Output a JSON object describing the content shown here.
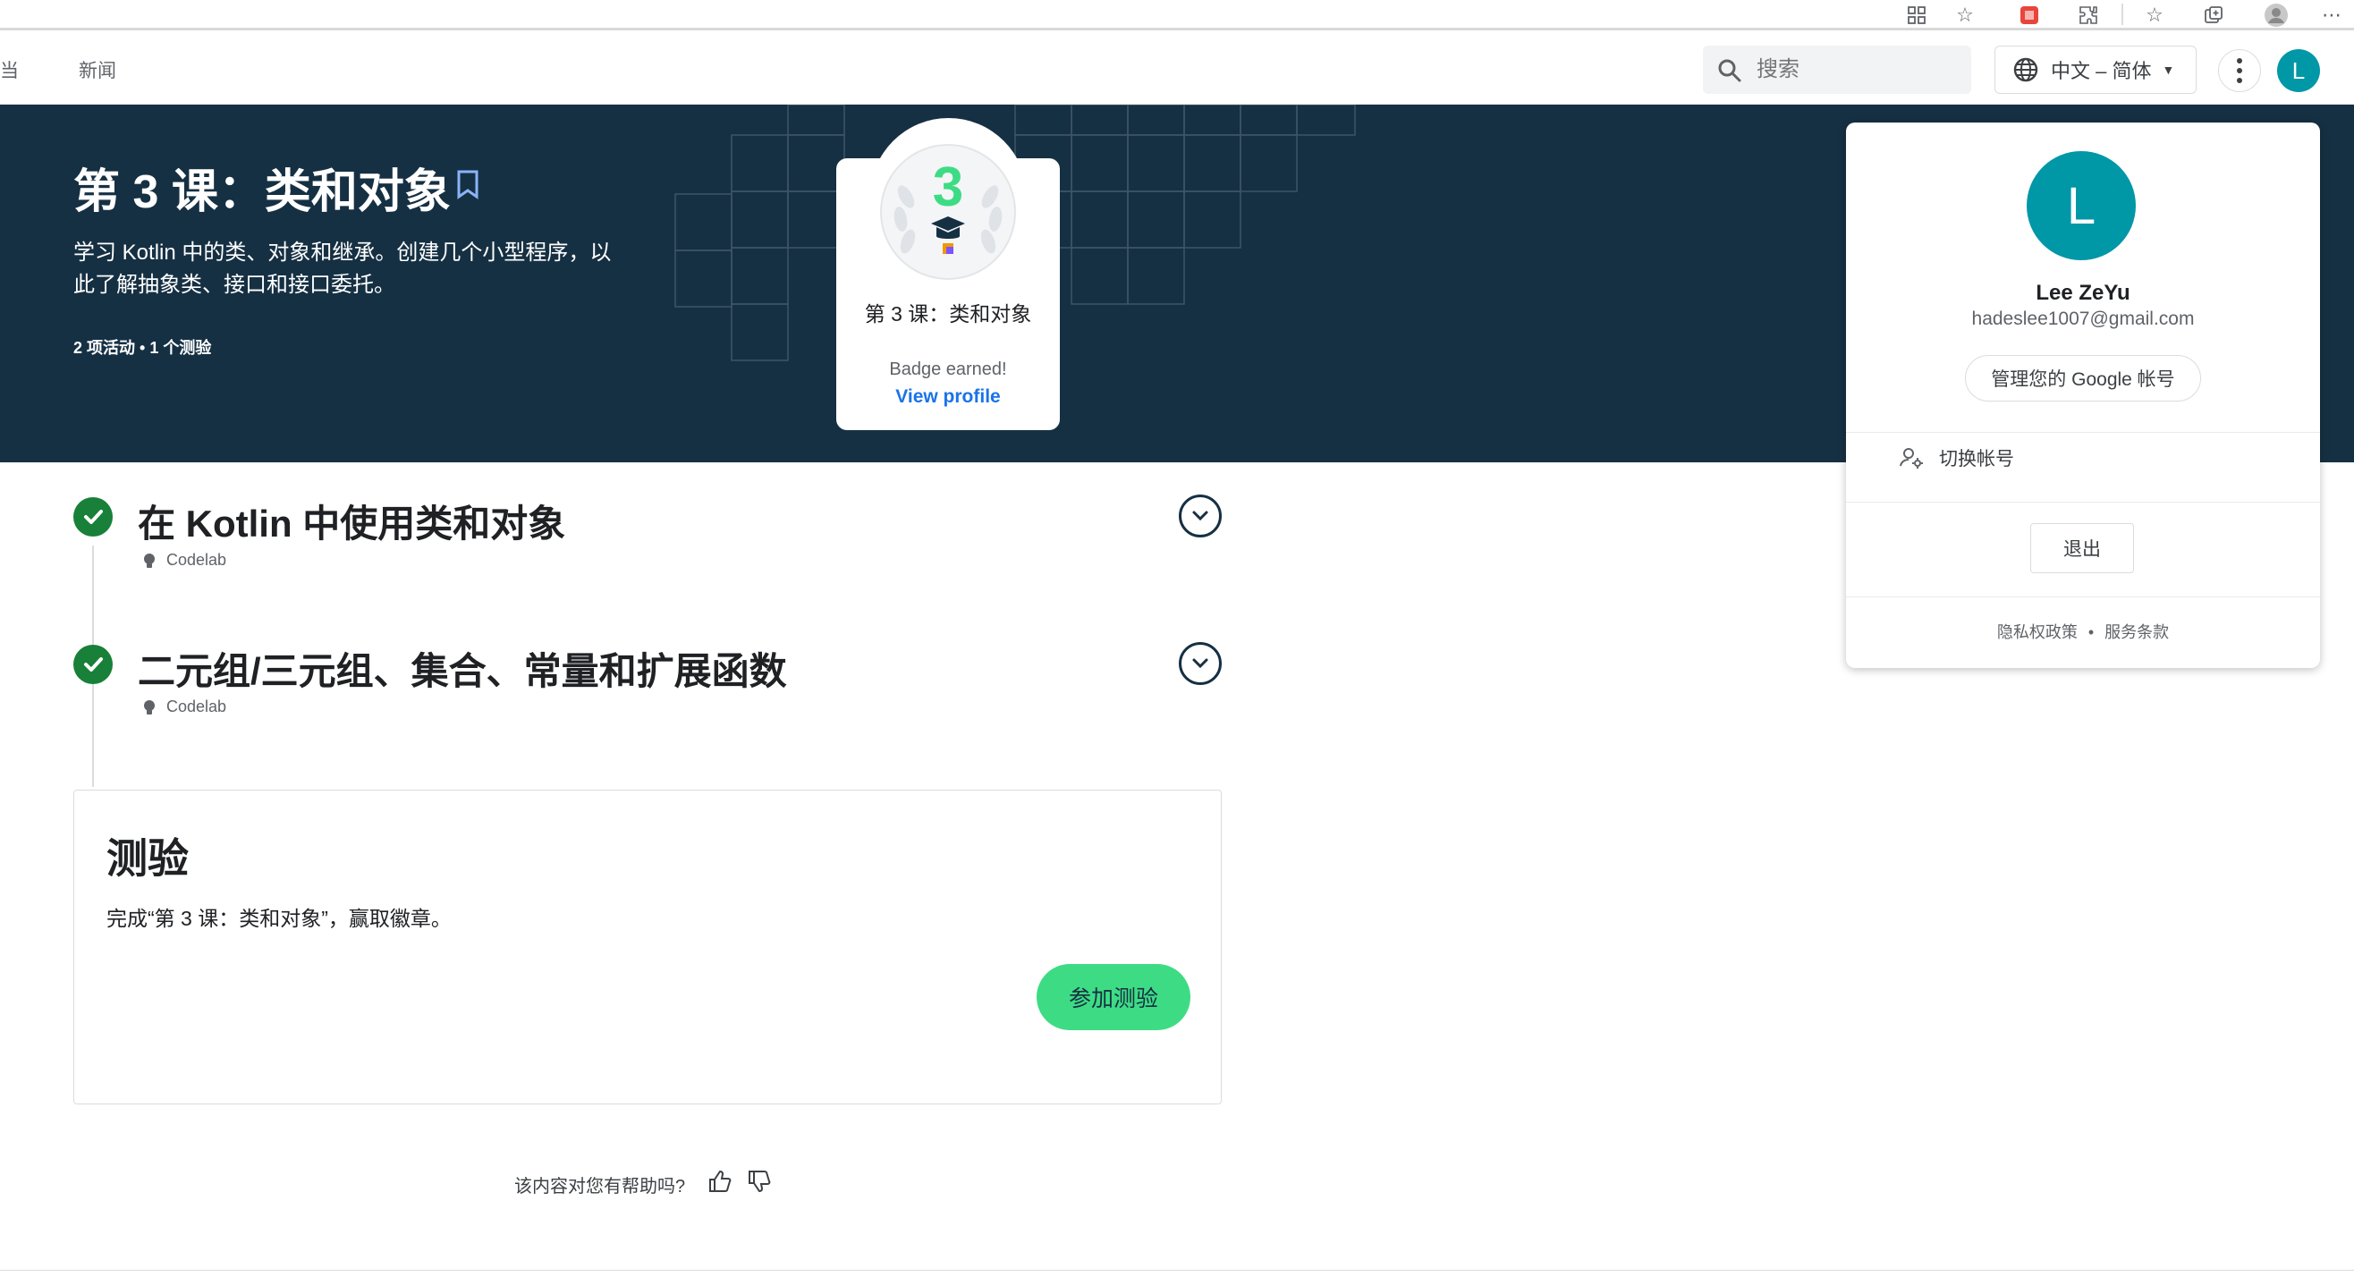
{
  "site_nav": {
    "cut_item": "当",
    "news": "新闻"
  },
  "search": {
    "placeholder": "搜索"
  },
  "language": {
    "selected": "中文 – 简体"
  },
  "user": {
    "initial": "L",
    "name": "Lee ZeYu",
    "email": "hadeslee1007@gmail.com"
  },
  "hero": {
    "title": "第 3 课：类和对象",
    "description": "学习 Kotlin 中的类、对象和继承。创建几个小型程序，以此了解抽象类、接口和接口委托。",
    "meta": "2 项活动 • 1 个测验"
  },
  "badge": {
    "number": "3",
    "name": "第 3 课：类和对象",
    "earned": "Badge earned!",
    "link": "View profile"
  },
  "activities": [
    {
      "title": "在 Kotlin 中使用类和对象",
      "type": "Codelab"
    },
    {
      "title": "二元组/三元组、集合、常量和扩展函数",
      "type": "Codelab"
    }
  ],
  "quiz": {
    "title": "测验",
    "description": "完成“第 3 课：类和对象”，赢取徽章。",
    "button": "参加测验"
  },
  "feedback": {
    "question": "该内容对您有帮助吗?"
  },
  "account_menu": {
    "manage": "管理您的 Google 帐号",
    "switch": "切换帐号",
    "signout": "退出",
    "privacy": "隐私权政策",
    "terms": "服务条款"
  },
  "colors": {
    "hero_bg": "#163043",
    "accent_green": "#3ddc84",
    "check_green": "#188038",
    "avatar_teal": "#0097a7",
    "link_blue": "#1a73e8"
  }
}
